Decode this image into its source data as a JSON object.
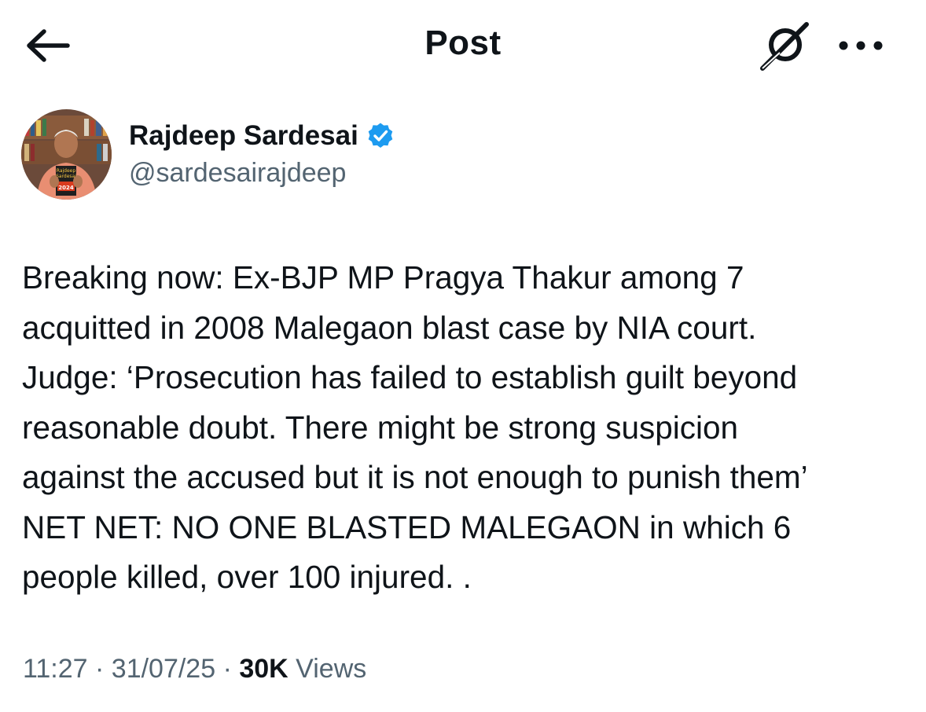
{
  "header": {
    "title": "Post",
    "back_icon": "arrow-left-icon",
    "grok_icon": "grok-icon",
    "more_icon": "more-horizontal-icon"
  },
  "author": {
    "display_name": "Rajdeep Sardesai",
    "handle": "@sardesairajdeep",
    "verified": true,
    "verified_color": "#1d9bf0",
    "avatar_book_title": [
      "Rajdeep",
      "Sardesai",
      "2024"
    ]
  },
  "post": {
    "lines": [
      "Breaking now: Ex-BJP MP Pragya Thakur among 7",
      "acquitted in 2008 Malegaon blast case by NIA court.",
      "Judge: ‘Prosecution has failed to establish guilt beyond",
      "reasonable doubt. There might be strong suspicion",
      "against the accused but it is not enough to punish them’",
      "NET NET: NO ONE BLASTED MALEGAON in which 6",
      "people killed, over 100 injured. ."
    ]
  },
  "meta": {
    "time": "11:27",
    "separator": " · ",
    "date": "31/07/25",
    "views_count": "30K",
    "views_label": " Views"
  },
  "colors": {
    "text": "#0f1419",
    "secondary": "#536471",
    "accent": "#1d9bf0",
    "background": "#ffffff"
  }
}
